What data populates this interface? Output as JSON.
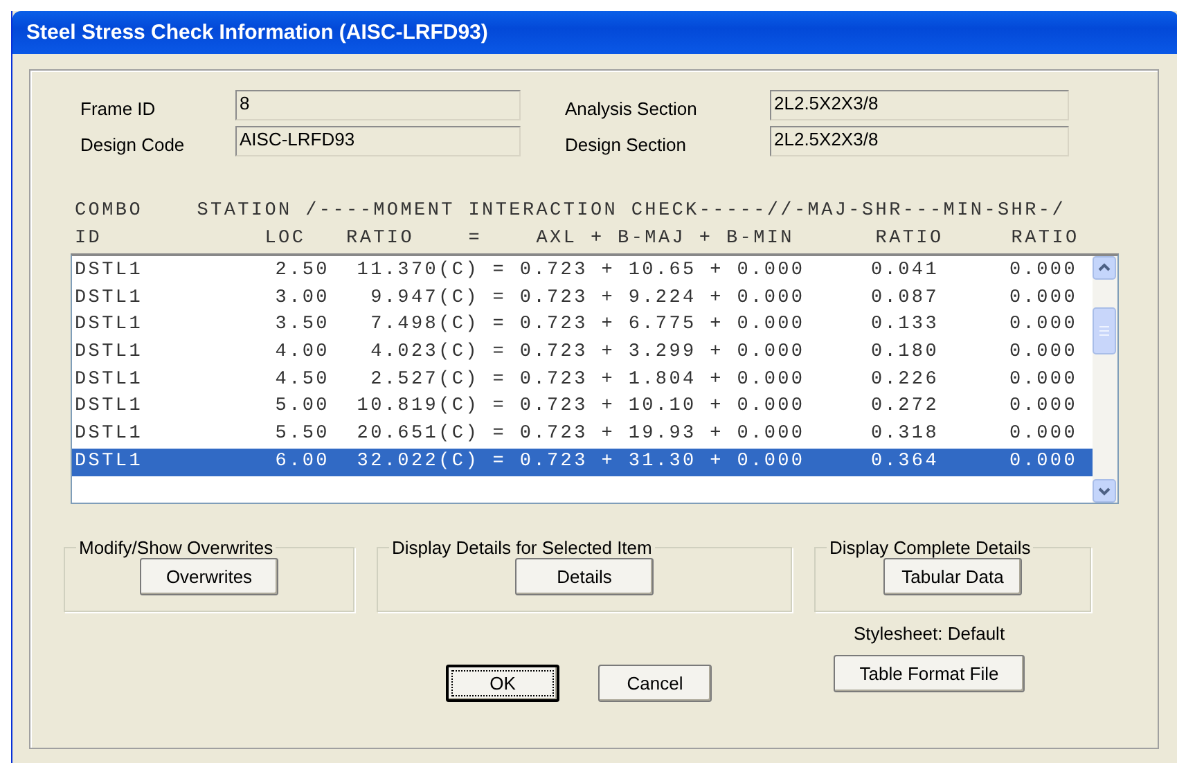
{
  "window": {
    "title": "Steel Stress Check Information (AISC-LRFD93)"
  },
  "fields": [
    {
      "label": "Frame ID",
      "value": "8"
    },
    {
      "label": "Analysis Section",
      "value": "2L2.5X2X3/8"
    },
    {
      "label": "Design Code",
      "value": "AISC-LRFD93"
    },
    {
      "label": "Design Section",
      "value": "2L2.5X2X3/8"
    }
  ],
  "table": {
    "header_lines": [
      "COMBO    STATION /----MOMENT INTERACTION CHECK-----//-MAJ-SHR---MIN-SHR-/",
      "ID            LOC   RATIO    =    AXL + B-MAJ + B-MIN      RATIO     RATIO"
    ],
    "rows": [
      {
        "combo": "DSTL1",
        "loc": "2.50",
        "ratio": "11.370(C)",
        "equation": "= 0.723 + 10.65 + 0.000",
        "maj_shr": "0.041",
        "min_shr": "0.000",
        "selected": false
      },
      {
        "combo": "DSTL1",
        "loc": "3.00",
        "ratio": "9.947(C)",
        "equation": "= 0.723 + 9.224 + 0.000",
        "maj_shr": "0.087",
        "min_shr": "0.000",
        "selected": false
      },
      {
        "combo": "DSTL1",
        "loc": "3.50",
        "ratio": "7.498(C)",
        "equation": "= 0.723 + 6.775 + 0.000",
        "maj_shr": "0.133",
        "min_shr": "0.000",
        "selected": false
      },
      {
        "combo": "DSTL1",
        "loc": "4.00",
        "ratio": "4.023(C)",
        "equation": "= 0.723 + 3.299 + 0.000",
        "maj_shr": "0.180",
        "min_shr": "0.000",
        "selected": false
      },
      {
        "combo": "DSTL1",
        "loc": "4.50",
        "ratio": "2.527(C)",
        "equation": "= 0.723 + 1.804 + 0.000",
        "maj_shr": "0.226",
        "min_shr": "0.000",
        "selected": false
      },
      {
        "combo": "DSTL1",
        "loc": "5.00",
        "ratio": "10.819(C)",
        "equation": "= 0.723 + 10.10 + 0.000",
        "maj_shr": "0.272",
        "min_shr": "0.000",
        "selected": false
      },
      {
        "combo": "DSTL1",
        "loc": "5.50",
        "ratio": "20.651(C)",
        "equation": "= 0.723 + 19.93 + 0.000",
        "maj_shr": "0.318",
        "min_shr": "0.000",
        "selected": false
      },
      {
        "combo": "DSTL1",
        "loc": "6.00",
        "ratio": "32.022(C)",
        "equation": "= 0.723 + 31.30 + 0.000",
        "maj_shr": "0.364",
        "min_shr": "0.000",
        "selected": true
      }
    ]
  },
  "groups": [
    {
      "title": "Modify/Show Overwrites",
      "button": "Overwrites"
    },
    {
      "title": "Display Details for Selected Item",
      "button": "Details"
    },
    {
      "title": "Display Complete Details",
      "button": "Tabular Data"
    }
  ],
  "stylesheet": "Stylesheet: Default",
  "buttons": [
    {
      "label": "OK",
      "focused": true
    },
    {
      "label": "Cancel",
      "focused": false
    }
  ],
  "format_button": "Table Format File"
}
